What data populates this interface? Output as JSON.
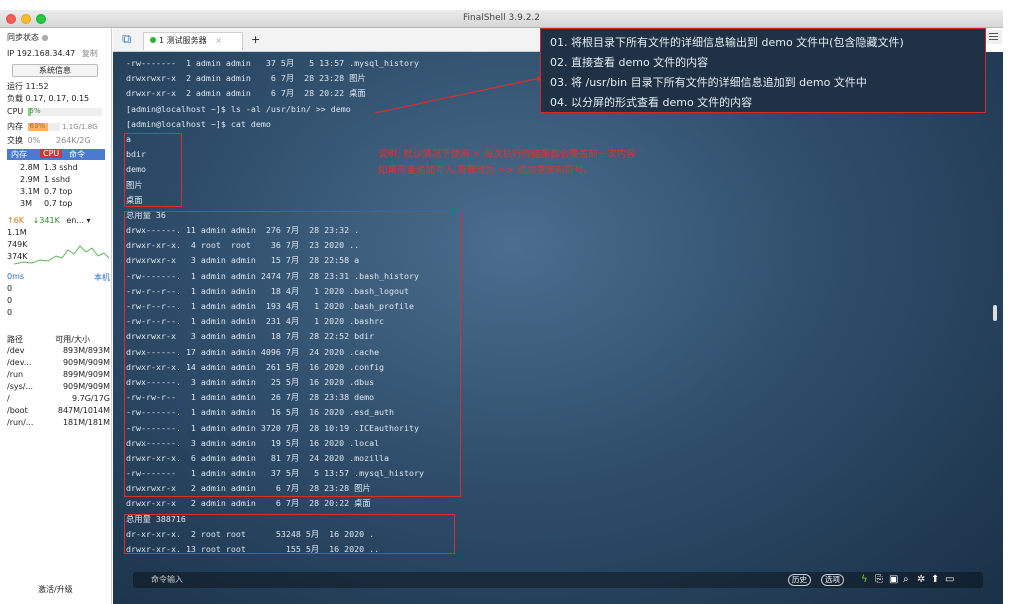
{
  "app": {
    "title": "FinalShell 3.9.2.2"
  },
  "sidebar": {
    "sync_status": "同步状态",
    "ip": "IP 192.168.34.47",
    "copy": "复制",
    "sysinfo_button": "系统信息",
    "uptime": "运行 11:52",
    "load": "负载 0.17, 0.17, 0.15",
    "cpu_label": "CPU",
    "cpu_value": "5%",
    "mem_label": "内存",
    "mem_pct": "63%",
    "mem_value": "1.1G/1.8G",
    "swap_label": "交换",
    "swap_pct": "0%",
    "swap_value": "264K/2G",
    "proc_tabs": [
      "内存",
      "CPU",
      "命令"
    ],
    "processes": [
      {
        "mem": "2.8M",
        "cmd": "1.3 sshd"
      },
      {
        "mem": "2.9M",
        "cmd": "1 sshd"
      },
      {
        "mem": "3.1M",
        "cmd": "0.7 top"
      },
      {
        "mem": "3M",
        "cmd": "0.7 top"
      }
    ],
    "net_up": "↑6K",
    "net_down": "↓341K",
    "net_iface": "en...",
    "net_scale": [
      "1.1M",
      "749K",
      "374K"
    ],
    "ping": "0ms",
    "ping_host": "本机",
    "ping_vals": [
      "0",
      "0",
      "0"
    ],
    "disk_header": {
      "path": "路径",
      "size": "可用/大小"
    },
    "disks": [
      {
        "path": "/dev",
        "size": "893M/893M"
      },
      {
        "path": "/dev...",
        "size": "909M/909M"
      },
      {
        "path": "/run",
        "size": "899M/909M"
      },
      {
        "path": "/sys/...",
        "size": "909M/909M"
      },
      {
        "path": "/",
        "size": "9.7G/17G"
      },
      {
        "path": "/boot",
        "size": "847M/1014M"
      },
      {
        "path": "/run/...",
        "size": "181M/181M"
      }
    ],
    "activate": "激活/升级"
  },
  "tabs": [
    {
      "label": "1 测试服务器"
    }
  ],
  "overlay": {
    "items": [
      "01. 将根目录下所有文件的详细信息输出到 demo 文件中(包含隐藏文件)",
      "02. 直接查看 demo 文件的内容",
      "03. 将 /usr/bin 目录下所有文件的详细信息追加到 demo 文件中",
      "04. 以分屏的形式查看 demo 文件的内容"
    ]
  },
  "terminal": {
    "lines": [
      "-rw-------  1 admin admin   37 5月   5 13:57 .mysql_history",
      "drwxrwxr-x  2 admin admin    6 7月  28 23:28 图片",
      "drwxr-xr-x  2 admin admin    6 7月  28 20:22 桌面",
      "[admin@localhost ~]$ ls -al /usr/bin/ >> demo",
      "[admin@localhost ~]$ cat demo",
      "a",
      "bdir",
      "demo",
      "图片",
      "桌面",
      "总用量 36",
      "drwx------. 11 admin admin  276 7月  28 23:32 .",
      "drwxr-xr-x.  4 root  root    36 7月  23 2020 ..",
      "drwxrwxr-x   3 admin admin   15 7月  28 22:58 a",
      "-rw-------.  1 admin admin 2474 7月  28 23:31 .bash_history",
      "-rw-r--r--.  1 admin admin   18 4月   1 2020 .bash_logout",
      "-rw-r--r--.  1 admin admin  193 4月   1 2020 .bash_profile",
      "-rw-r--r--.  1 admin admin  231 4月   1 2020 .bashrc",
      "drwxrwxr-x   3 admin admin   18 7月  28 22:52 bdir",
      "drwx------. 17 admin admin 4096 7月  24 2020 .cache",
      "drwxr-xr-x. 14 admin admin  261 5月  16 2020 .config",
      "drwx------.  3 admin admin   25 5月  16 2020 .dbus",
      "-rw-rw-r--   1 admin admin   26 7月  28 23:38 demo",
      "-rw-------.  1 admin admin   16 5月  16 2020 .esd_auth",
      "-rw-------.  1 admin admin 3720 7月  28 10:19 .ICEauthority",
      "drwx------.  3 admin admin   19 5月  16 2020 .local",
      "drwxr-xr-x.  6 admin admin   81 7月  24 2020 .mozilla",
      "-rw-------   1 admin admin   37 5月   5 13:57 .mysql_history",
      "drwxrwxr-x   2 admin admin    6 7月  28 23:28 图片",
      "drwxr-xr-x   2 admin admin    6 7月  28 20:22 桌面",
      "总用量 388716",
      "dr-xr-xr-x.  2 root root      53248 5月  16 2020 .",
      "drwxr-xr-x. 13 root root        155 5月  16 2020 .."
    ],
    "note_lines": [
      "说明: 默认情况下使用 > 每次执行的结果都会覆盖前一次内容",
      "如果需要追加写入,需要改为 >> 追加重定向符号。"
    ],
    "cmd_placeholder": "命令输入",
    "cmd_buttons": [
      "历史",
      "选项"
    ]
  },
  "colors": {
    "accent_red": "#d33030",
    "proc_tab_blue": "#4a7bd0",
    "cpu_bar": "#7fd07f",
    "mem_bar": "#f2b36b"
  },
  "levels": {
    "cpu": 0.05,
    "mem": 0.63,
    "swap": 0.0
  }
}
